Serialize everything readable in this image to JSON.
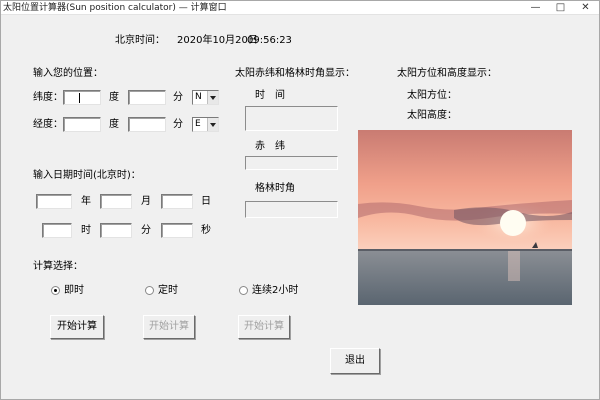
{
  "window": {
    "title": "太阳位置计算器(Sun position calculator) — 计算窗口",
    "minimize": "—",
    "maximize": "□",
    "close": "✕"
  },
  "clock": {
    "label": "北京时间：",
    "date": "2020年10月20日",
    "time": "09:56:23"
  },
  "location": {
    "header": "输入您的位置：",
    "latitude_label": "纬度：",
    "longitude_label": "经度：",
    "degree_unit": "度",
    "minute_unit": "分",
    "latitude_dir": "N",
    "longitude_dir": "E"
  },
  "datetime": {
    "header": "输入日期时间(北京时)：",
    "year_unit": "年",
    "month_unit": "月",
    "day_unit": "日",
    "hour_unit": "时",
    "minute_unit": "分",
    "second_unit": "秒"
  },
  "calc": {
    "header": "计算选择：",
    "options": [
      "即时",
      "定时",
      "连续2小时"
    ],
    "start_label": "开始计算"
  },
  "solar": {
    "header": "太阳赤纬和格林时角显示：",
    "time_label": "时　间",
    "declination_label": "赤　纬",
    "hour_angle_label": "格林时角"
  },
  "sun": {
    "header": "太阳方位和高度显示：",
    "azimuth_label": "太阳方位：",
    "altitude_label": "太阳高度："
  },
  "exit_label": "退出",
  "colors": {
    "sky_top": "#ca7a70",
    "sky_mid": "#f5a28a",
    "horizon": "#fbc9b3",
    "sea": "#6c7680",
    "sun": "#fffdf0"
  }
}
